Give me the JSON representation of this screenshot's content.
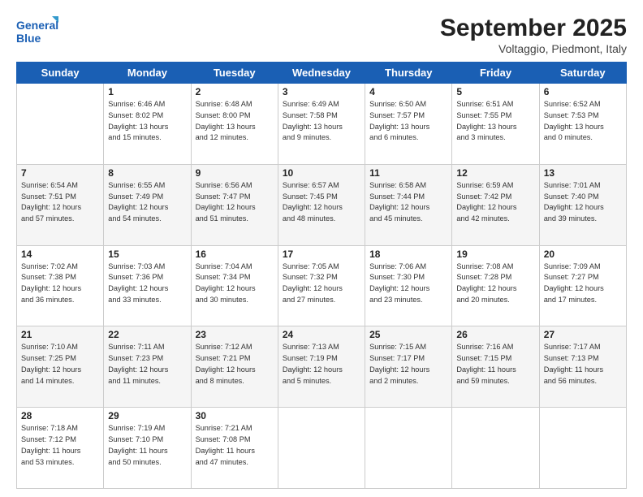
{
  "logo": {
    "line1": "General",
    "line2": "Blue"
  },
  "title": "September 2025",
  "location": "Voltaggio, Piedmont, Italy",
  "days_of_week": [
    "Sunday",
    "Monday",
    "Tuesday",
    "Wednesday",
    "Thursday",
    "Friday",
    "Saturday"
  ],
  "weeks": [
    [
      {
        "day": "",
        "info": ""
      },
      {
        "day": "1",
        "info": "Sunrise: 6:46 AM\nSunset: 8:02 PM\nDaylight: 13 hours\nand 15 minutes."
      },
      {
        "day": "2",
        "info": "Sunrise: 6:48 AM\nSunset: 8:00 PM\nDaylight: 13 hours\nand 12 minutes."
      },
      {
        "day": "3",
        "info": "Sunrise: 6:49 AM\nSunset: 7:58 PM\nDaylight: 13 hours\nand 9 minutes."
      },
      {
        "day": "4",
        "info": "Sunrise: 6:50 AM\nSunset: 7:57 PM\nDaylight: 13 hours\nand 6 minutes."
      },
      {
        "day": "5",
        "info": "Sunrise: 6:51 AM\nSunset: 7:55 PM\nDaylight: 13 hours\nand 3 minutes."
      },
      {
        "day": "6",
        "info": "Sunrise: 6:52 AM\nSunset: 7:53 PM\nDaylight: 13 hours\nand 0 minutes."
      }
    ],
    [
      {
        "day": "7",
        "info": "Sunrise: 6:54 AM\nSunset: 7:51 PM\nDaylight: 12 hours\nand 57 minutes."
      },
      {
        "day": "8",
        "info": "Sunrise: 6:55 AM\nSunset: 7:49 PM\nDaylight: 12 hours\nand 54 minutes."
      },
      {
        "day": "9",
        "info": "Sunrise: 6:56 AM\nSunset: 7:47 PM\nDaylight: 12 hours\nand 51 minutes."
      },
      {
        "day": "10",
        "info": "Sunrise: 6:57 AM\nSunset: 7:45 PM\nDaylight: 12 hours\nand 48 minutes."
      },
      {
        "day": "11",
        "info": "Sunrise: 6:58 AM\nSunset: 7:44 PM\nDaylight: 12 hours\nand 45 minutes."
      },
      {
        "day": "12",
        "info": "Sunrise: 6:59 AM\nSunset: 7:42 PM\nDaylight: 12 hours\nand 42 minutes."
      },
      {
        "day": "13",
        "info": "Sunrise: 7:01 AM\nSunset: 7:40 PM\nDaylight: 12 hours\nand 39 minutes."
      }
    ],
    [
      {
        "day": "14",
        "info": "Sunrise: 7:02 AM\nSunset: 7:38 PM\nDaylight: 12 hours\nand 36 minutes."
      },
      {
        "day": "15",
        "info": "Sunrise: 7:03 AM\nSunset: 7:36 PM\nDaylight: 12 hours\nand 33 minutes."
      },
      {
        "day": "16",
        "info": "Sunrise: 7:04 AM\nSunset: 7:34 PM\nDaylight: 12 hours\nand 30 minutes."
      },
      {
        "day": "17",
        "info": "Sunrise: 7:05 AM\nSunset: 7:32 PM\nDaylight: 12 hours\nand 27 minutes."
      },
      {
        "day": "18",
        "info": "Sunrise: 7:06 AM\nSunset: 7:30 PM\nDaylight: 12 hours\nand 23 minutes."
      },
      {
        "day": "19",
        "info": "Sunrise: 7:08 AM\nSunset: 7:28 PM\nDaylight: 12 hours\nand 20 minutes."
      },
      {
        "day": "20",
        "info": "Sunrise: 7:09 AM\nSunset: 7:27 PM\nDaylight: 12 hours\nand 17 minutes."
      }
    ],
    [
      {
        "day": "21",
        "info": "Sunrise: 7:10 AM\nSunset: 7:25 PM\nDaylight: 12 hours\nand 14 minutes."
      },
      {
        "day": "22",
        "info": "Sunrise: 7:11 AM\nSunset: 7:23 PM\nDaylight: 12 hours\nand 11 minutes."
      },
      {
        "day": "23",
        "info": "Sunrise: 7:12 AM\nSunset: 7:21 PM\nDaylight: 12 hours\nand 8 minutes."
      },
      {
        "day": "24",
        "info": "Sunrise: 7:13 AM\nSunset: 7:19 PM\nDaylight: 12 hours\nand 5 minutes."
      },
      {
        "day": "25",
        "info": "Sunrise: 7:15 AM\nSunset: 7:17 PM\nDaylight: 12 hours\nand 2 minutes."
      },
      {
        "day": "26",
        "info": "Sunrise: 7:16 AM\nSunset: 7:15 PM\nDaylight: 11 hours\nand 59 minutes."
      },
      {
        "day": "27",
        "info": "Sunrise: 7:17 AM\nSunset: 7:13 PM\nDaylight: 11 hours\nand 56 minutes."
      }
    ],
    [
      {
        "day": "28",
        "info": "Sunrise: 7:18 AM\nSunset: 7:12 PM\nDaylight: 11 hours\nand 53 minutes."
      },
      {
        "day": "29",
        "info": "Sunrise: 7:19 AM\nSunset: 7:10 PM\nDaylight: 11 hours\nand 50 minutes."
      },
      {
        "day": "30",
        "info": "Sunrise: 7:21 AM\nSunset: 7:08 PM\nDaylight: 11 hours\nand 47 minutes."
      },
      {
        "day": "",
        "info": ""
      },
      {
        "day": "",
        "info": ""
      },
      {
        "day": "",
        "info": ""
      },
      {
        "day": "",
        "info": ""
      }
    ]
  ]
}
